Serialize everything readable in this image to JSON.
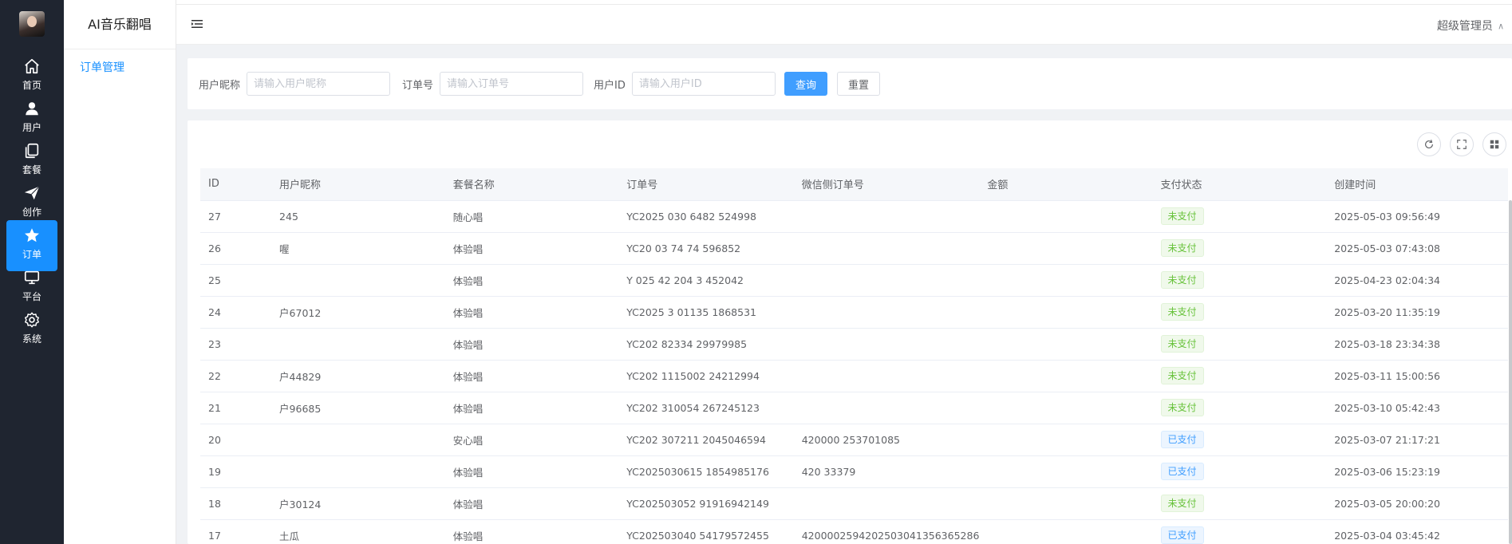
{
  "app": {
    "title": "AI音乐翻唱"
  },
  "rail": {
    "items": [
      {
        "label": "首页",
        "icon": "home-icon"
      },
      {
        "label": "用户",
        "icon": "user-icon"
      },
      {
        "label": "套餐",
        "icon": "package-icon"
      },
      {
        "label": "创作",
        "icon": "send-icon"
      },
      {
        "label": "订单",
        "icon": "star-icon",
        "active": true
      },
      {
        "label": "平台",
        "icon": "monitor-icon"
      },
      {
        "label": "系统",
        "icon": "gear-icon"
      }
    ]
  },
  "submenu": {
    "item": "订单管理"
  },
  "header": {
    "user": "超级管理员"
  },
  "filters": {
    "nickname_label": "用户昵称",
    "nickname_placeholder": "请输入用户昵称",
    "order_label": "订单号",
    "order_placeholder": "请输入订单号",
    "userid_label": "用户ID",
    "userid_placeholder": "请输入用户ID",
    "search_button": "查询",
    "reset_button": "重置"
  },
  "table": {
    "columns": [
      "ID",
      "用户昵称",
      "套餐名称",
      "订单号",
      "微信侧订单号",
      "金额",
      "支付状态",
      "创建时间"
    ],
    "rows": [
      {
        "id": "27",
        "nickname": "245",
        "package": "随心唱",
        "order_no": "YC2025 030 6482 524998",
        "wx_no": "",
        "amount": "",
        "status": "未支付",
        "created": "2025-05-03 09:56:49"
      },
      {
        "id": "26",
        "nickname": "喔",
        "package": "体验唱",
        "order_no": "YC20 03 74 74 596852",
        "wx_no": "",
        "amount": "",
        "status": "未支付",
        "created": "2025-05-03 07:43:08"
      },
      {
        "id": "25",
        "nickname": "",
        "package": "体验唱",
        "order_no": "Y 025 42 204 3 452042",
        "wx_no": "",
        "amount": "",
        "status": "未支付",
        "created": "2025-04-23 02:04:34"
      },
      {
        "id": "24",
        "nickname": "户67012",
        "package": "体验唱",
        "order_no": "YC2025 3 01135 1868531",
        "wx_no": "",
        "amount": "",
        "status": "未支付",
        "created": "2025-03-20 11:35:19"
      },
      {
        "id": "23",
        "nickname": "",
        "package": "体验唱",
        "order_no": "YC202 82334 29979985",
        "wx_no": "",
        "amount": "",
        "status": "未支付",
        "created": "2025-03-18 23:34:38"
      },
      {
        "id": "22",
        "nickname": "户44829",
        "package": "体验唱",
        "order_no": "YC202 1115002 24212994",
        "wx_no": "",
        "amount": "",
        "status": "未支付",
        "created": "2025-03-11 15:00:56"
      },
      {
        "id": "21",
        "nickname": "户96685",
        "package": "体验唱",
        "order_no": "YC202 310054 267245123",
        "wx_no": "",
        "amount": "",
        "status": "未支付",
        "created": "2025-03-10 05:42:43"
      },
      {
        "id": "20",
        "nickname": "",
        "package": "安心唱",
        "order_no": "YC202 307211 2045046594",
        "wx_no": "420000 253701085",
        "amount": "",
        "status": "已支付",
        "created": "2025-03-07 21:17:21"
      },
      {
        "id": "19",
        "nickname": "",
        "package": "体验唱",
        "order_no": "YC2025030615 1854985176",
        "wx_no": "420 33379",
        "amount": "",
        "status": "已支付",
        "created": "2025-03-06 15:23:19"
      },
      {
        "id": "18",
        "nickname": "户30124",
        "package": "体验唱",
        "order_no": "YC202503052 91916942149",
        "wx_no": "",
        "amount": "",
        "status": "未支付",
        "created": "2025-03-05 20:00:20"
      },
      {
        "id": "17",
        "nickname": "土瓜",
        "package": "体验唱",
        "order_no": "YC202503040 54179572455",
        "wx_no": "4200002594202503041356365286",
        "amount": "",
        "status": "已支付",
        "created": "2025-03-04 03:45:42"
      }
    ]
  },
  "colors": {
    "primary": "#409eff",
    "rail_bg": "#1f2530",
    "active_bg": "#1890ff",
    "unpaid": "#67c23a",
    "paid": "#409eff"
  }
}
